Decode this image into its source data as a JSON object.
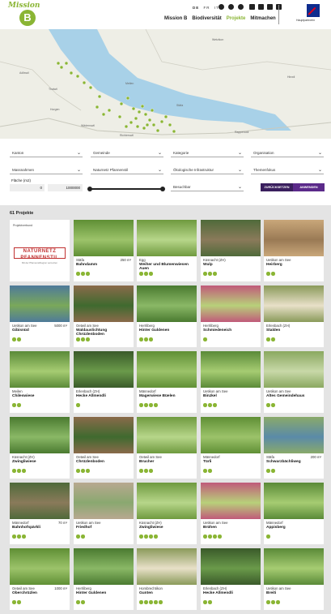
{
  "header": {
    "logo_word": "Mission",
    "logo_letter": "B",
    "languages": [
      "DE",
      "FR",
      "IT"
    ],
    "nav": [
      {
        "label": "Mission B",
        "active": false
      },
      {
        "label": "Biodiversität",
        "active": false
      },
      {
        "label": "Projekte",
        "active": true
      },
      {
        "label": "Mitmachen",
        "active": false
      }
    ],
    "partner_label": "Hauptpartnerin"
  },
  "map": {
    "labels": [
      "Adliswil",
      "Thalwil",
      "Wädenswil",
      "Meilen",
      "Stäfa",
      "Rapperswil",
      "Horgen",
      "Richterswil",
      "Wetzikon",
      "Hinwil"
    ]
  },
  "filters": {
    "kanton": "Kanton",
    "gemeinde": "Gemeinde",
    "kategorie": "Kategorie",
    "organisation": "Organisation",
    "massnahmen": "Massnahmen",
    "naturnetz": "Naturnetz Pfannenstil",
    "infrastruktur": "Ökologische Infrastruktur",
    "themenfokus": "Themenfokus",
    "flaeche_label": "Fläche (m2)",
    "min_value": "0",
    "max_value": "1000000",
    "besuchbar": "Besuchbar",
    "reset_label": "ZURÜCKSETZEN",
    "apply_label": "ANWENDEN"
  },
  "projects": {
    "count_label": "61 Projekte",
    "special_card": {
      "title": "Projektverbund",
      "logo": "NATURNETZ PFANNENSTIL",
      "logo_sub": "Mit der Pfannenstilregion vernetzen"
    },
    "cards": [
      {
        "loc": "Stäfa",
        "area": "250 m²",
        "name": "Bahndamm",
        "dots": 3,
        "img": "meadow"
      },
      {
        "loc": "Egg",
        "area": "",
        "name": "Weiher und Blumenwiesen Auen",
        "dots": 3,
        "img": "field"
      },
      {
        "loc": "Küsnacht (ZH)",
        "area": "",
        "name": "Wulp",
        "dots": 3,
        "img": "soil"
      },
      {
        "loc": "Uetikon am See",
        "area": "",
        "name": "Heirberg",
        "dots": 2,
        "img": "plowed"
      },
      {
        "loc": "Uetikon am See",
        "area": "5000 m²",
        "name": "Gibisnüd",
        "dots": 2,
        "img": "pond"
      },
      {
        "loc": "Oetwil am See",
        "area": "",
        "name": "Waldauslichtung Chrüzlenboden",
        "dots": 3,
        "img": "forest"
      },
      {
        "loc": "Herrliberg",
        "area": "",
        "name": "Hinter Guldenen",
        "dots": 3,
        "img": "orchard"
      },
      {
        "loc": "Herrliberg",
        "area": "",
        "name": "Schmiedeneich",
        "dots": 1,
        "img": "flowers"
      },
      {
        "loc": "Erlenbach (ZH)",
        "area": "",
        "name": "Stalden",
        "dots": 2,
        "img": "wildflowers"
      },
      {
        "loc": "Meilen",
        "area": "",
        "name": "Chileswiese",
        "dots": 2,
        "img": "green"
      },
      {
        "loc": "Erlenbach (ZH)",
        "area": "",
        "name": "Hecke Allmendli",
        "dots": 1,
        "img": "forest2"
      },
      {
        "loc": "Männedorf",
        "area": "",
        "name": "Magerwiese Büelen",
        "dots": 4,
        "img": "meadow"
      },
      {
        "loc": "Uetikon am See",
        "area": "",
        "name": "Binzkel",
        "dots": 3,
        "img": "green"
      },
      {
        "loc": "Uetikon am See",
        "area": "",
        "name": "Altes Gemeindehaus",
        "dots": 2,
        "img": "garden"
      },
      {
        "loc": "Küsnacht (ZH)",
        "area": "",
        "name": "Zwingliwiese",
        "dots": 3,
        "img": "orchard"
      },
      {
        "loc": "Oetwil am See",
        "area": "",
        "name": "Chrüzlenboden",
        "dots": 3,
        "img": "forest"
      },
      {
        "loc": "Oetwil am See",
        "area": "",
        "name": "Brucher",
        "dots": 3,
        "img": "field"
      },
      {
        "loc": "Männedorf",
        "area": "",
        "name": "Türli",
        "dots": 2,
        "img": "meadow"
      },
      {
        "loc": "Stäfa",
        "area": "200 m²",
        "name": "Schwarzbächliweg",
        "dots": 2,
        "img": "pond2"
      },
      {
        "loc": "Männedorf",
        "area": "70 m²",
        "name": "Bahnhofspärkli",
        "dots": 3,
        "img": "soil"
      },
      {
        "loc": "Uetikon am See",
        "area": "",
        "name": "Friedhof",
        "dots": 2,
        "img": "path"
      },
      {
        "loc": "Küsnacht (ZH)",
        "area": "",
        "name": "Zwingliwiese",
        "dots": 4,
        "img": "field"
      },
      {
        "loc": "Uetikon am See",
        "area": "",
        "name": "Brühen",
        "dots": 4,
        "img": "flowers"
      },
      {
        "loc": "Männedorf",
        "area": "",
        "name": "Appisberg",
        "dots": 1,
        "img": "green"
      },
      {
        "loc": "Oetwil am See",
        "area": "1000 m²",
        "name": "Oberchrüzlen",
        "dots": 2,
        "img": "meadow"
      },
      {
        "loc": "Herrliberg",
        "area": "",
        "name": "Hinter Guldenen",
        "dots": 2,
        "img": "orchard"
      },
      {
        "loc": "Hombrechtikon",
        "area": "",
        "name": "Gunten",
        "dots": 5,
        "img": "wildflowers"
      },
      {
        "loc": "Erlenbach (ZH)",
        "area": "",
        "name": "Hecke Allmendli",
        "dots": 2,
        "img": "forest2"
      },
      {
        "loc": "Uetikon am See",
        "area": "",
        "name": "Breiti",
        "dots": 3,
        "img": "green"
      }
    ]
  },
  "colors": {
    "accent": "#8ab534",
    "button_dark": "#3a1f5e",
    "button_purple": "#5b2a8a"
  }
}
